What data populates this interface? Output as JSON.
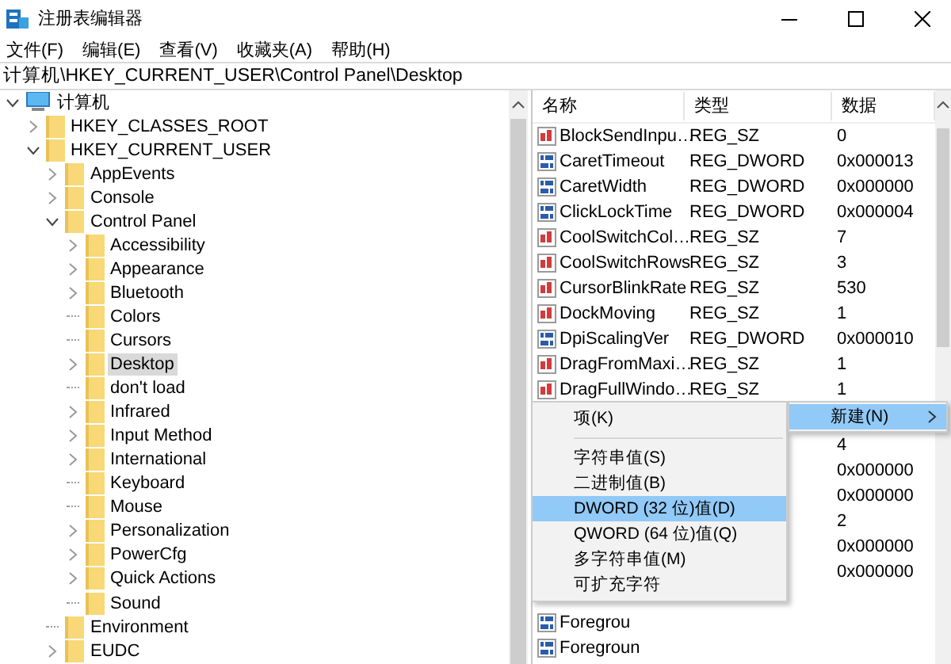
{
  "window": {
    "title": "注册表编辑器"
  },
  "menu": [
    "文件(F)",
    "编辑(E)",
    "查看(V)",
    "收藏夹(A)",
    "帮助(H)"
  ],
  "address": "计算机\\HKEY_CURRENT_USER\\Control Panel\\Desktop",
  "tree": [
    {
      "label": "计算机",
      "kind": "open",
      "selected": false,
      "children": [
        {
          "label": "HKEY_CLASSES_ROOT",
          "kind": "closed",
          "selected": false
        },
        {
          "label": "HKEY_CURRENT_USER",
          "kind": "open",
          "selected": false,
          "children": [
            {
              "label": "AppEvents",
              "kind": "closed",
              "selected": false
            },
            {
              "label": "Console",
              "kind": "closed",
              "selected": false
            },
            {
              "label": "Control Panel",
              "kind": "open",
              "selected": false,
              "children": [
                {
                  "label": "Accessibility",
                  "kind": "closed",
                  "selected": false
                },
                {
                  "label": "Appearance",
                  "kind": "closed",
                  "selected": false
                },
                {
                  "label": "Bluetooth",
                  "kind": "closed",
                  "selected": false
                },
                {
                  "label": "Colors",
                  "kind": "leaf",
                  "selected": false
                },
                {
                  "label": "Cursors",
                  "kind": "leaf",
                  "selected": false
                },
                {
                  "label": "Desktop",
                  "kind": "closed",
                  "selected": true
                },
                {
                  "label": "don't load",
                  "kind": "leaf",
                  "selected": false
                },
                {
                  "label": "Infrared",
                  "kind": "closed",
                  "selected": false
                },
                {
                  "label": "Input Method",
                  "kind": "closed",
                  "selected": false
                },
                {
                  "label": "International",
                  "kind": "closed",
                  "selected": false
                },
                {
                  "label": "Keyboard",
                  "kind": "leaf",
                  "selected": false
                },
                {
                  "label": "Mouse",
                  "kind": "leaf",
                  "selected": false
                },
                {
                  "label": "Personalization",
                  "kind": "closed",
                  "selected": false
                },
                {
                  "label": "PowerCfg",
                  "kind": "closed",
                  "selected": false
                },
                {
                  "label": "Quick Actions",
                  "kind": "closed",
                  "selected": false
                },
                {
                  "label": "Sound",
                  "kind": "leaf",
                  "selected": false
                }
              ]
            },
            {
              "label": "Environment",
              "kind": "leaf",
              "selected": false
            },
            {
              "label": "EUDC",
              "kind": "closed",
              "selected": false
            }
          ]
        }
      ]
    }
  ],
  "list": {
    "columns": [
      "名称",
      "类型",
      "数据"
    ],
    "rows": [
      {
        "kind": "sz",
        "name": "BlockSendInpu…",
        "type": "REG_SZ",
        "data": "0"
      },
      {
        "kind": "dword",
        "name": "CaretTimeout",
        "type": "REG_DWORD",
        "data": "0x000013"
      },
      {
        "kind": "dword",
        "name": "CaretWidth",
        "type": "REG_DWORD",
        "data": "0x000000"
      },
      {
        "kind": "dword",
        "name": "ClickLockTime",
        "type": "REG_DWORD",
        "data": "0x000004"
      },
      {
        "kind": "sz",
        "name": "CoolSwitchCol…",
        "type": "REG_SZ",
        "data": "7"
      },
      {
        "kind": "sz",
        "name": "CoolSwitchRows",
        "type": "REG_SZ",
        "data": "3"
      },
      {
        "kind": "sz",
        "name": "CursorBlinkRate",
        "type": "REG_SZ",
        "data": "530"
      },
      {
        "kind": "sz",
        "name": "DockMoving",
        "type": "REG_SZ",
        "data": "1"
      },
      {
        "kind": "dword",
        "name": "DpiScalingVer",
        "type": "REG_DWORD",
        "data": "0x000010"
      },
      {
        "kind": "sz",
        "name": "DragFromMaxi…",
        "type": "REG_SZ",
        "data": "1"
      },
      {
        "kind": "sz",
        "name": "DragFullWindo…",
        "type": "REG_SZ",
        "data": "1"
      },
      {
        "data": "4"
      },
      {
        "data": "0x000000"
      },
      {
        "data": "0x000000"
      },
      {
        "data": "2"
      },
      {
        "data": "0x000000"
      },
      {
        "data": "0x000000"
      },
      {
        "kind": "dword",
        "name": "Foregrou"
      },
      {
        "kind": "dword",
        "name": "Foregroun"
      }
    ]
  },
  "context_menu": {
    "items": [
      {
        "label": "项(K)",
        "selected": false,
        "separator_after": true
      },
      {
        "label": "字符串值(S)",
        "selected": false,
        "separator_after": false
      },
      {
        "label": "二进制值(B)",
        "selected": false,
        "separator_after": false
      },
      {
        "label": "DWORD (32 位)值(D)",
        "selected": true,
        "separator_after": false
      },
      {
        "label": "QWORD (64 位)值(Q)",
        "selected": false,
        "separator_after": false
      },
      {
        "label": "多字符串值(M)",
        "selected": false,
        "separator_after": false
      },
      {
        "label": "可扩充字符",
        "selected": false,
        "separator_after": false
      }
    ]
  },
  "parent_menu": {
    "items": [
      {
        "label": "新建(N)",
        "selected": true
      }
    ]
  }
}
